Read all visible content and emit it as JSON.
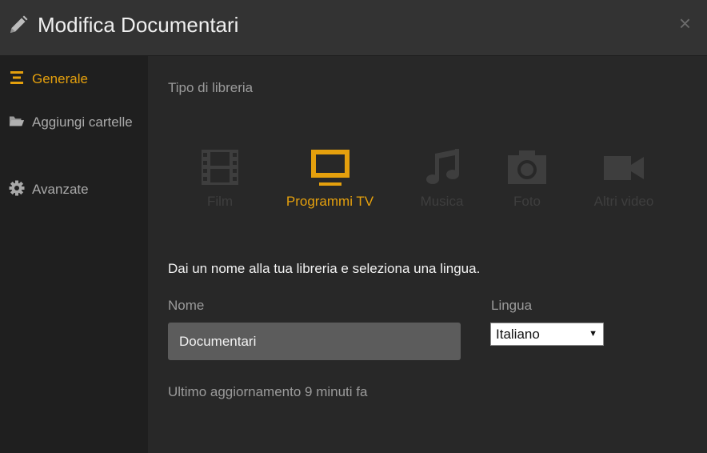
{
  "header": {
    "title": "Modifica Documentari",
    "close_label": "×",
    "icon": "pencil-icon"
  },
  "sidebar": {
    "items": [
      {
        "label": "Generale",
        "icon": "list-icon",
        "active": true
      },
      {
        "label": "Aggiungi cartelle",
        "icon": "folder-icon",
        "active": false
      },
      {
        "label": "Avanzate",
        "icon": "gear-icon",
        "active": false
      }
    ]
  },
  "main": {
    "section_label": "Tipo di libreria",
    "library_types": [
      {
        "label": "Film",
        "icon": "film-icon",
        "selected": false
      },
      {
        "label": "Programmi TV",
        "icon": "tv-icon",
        "selected": true
      },
      {
        "label": "Musica",
        "icon": "music-icon",
        "selected": false
      },
      {
        "label": "Foto",
        "icon": "camera-icon",
        "selected": false
      },
      {
        "label": "Altri video",
        "icon": "video-camera-icon",
        "selected": false
      }
    ],
    "instruction": "Dai un nome alla tua libreria e seleziona una lingua.",
    "name_label": "Nome",
    "name_value": "Documentari",
    "language_label": "Lingua",
    "language_value": "Italiano",
    "last_update": "Ultimo aggiornamento 9 minuti fa"
  },
  "colors": {
    "accent": "#e5a00d",
    "background": "#282828",
    "sidebar": "#1f1f1f",
    "header": "#333333",
    "inactive_icon": "#3e3e3e"
  }
}
